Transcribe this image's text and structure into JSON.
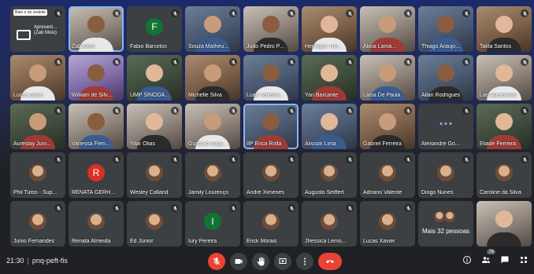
{
  "participants": [
    {
      "name": "Apresent... (Zeb Moio)",
      "kind": "screen",
      "caption": "Bato e do vedeite",
      "subcaption": "Apresent... (Zab Moio)"
    },
    {
      "name": "Zab Melo",
      "kind": "video",
      "style": "alt1",
      "speaking": true
    },
    {
      "name": "Fabio Barcelos",
      "kind": "avatar",
      "initial": "F",
      "color": "#137333"
    },
    {
      "name": "Souza Matheu...",
      "kind": "video",
      "style": "alt2"
    },
    {
      "name": "João Pedro P...",
      "kind": "video",
      "style": "alt1"
    },
    {
      "name": "Henrique Trin...",
      "kind": "video",
      "style": "alt3"
    },
    {
      "name": "Alicia Lama...",
      "kind": "video",
      "style": "alt1"
    },
    {
      "name": "Thiago Araujo...",
      "kind": "video",
      "style": "alt2"
    },
    {
      "name": "Talita Santos",
      "kind": "video",
      "style": "alt3"
    },
    {
      "name": "Lucas Grion",
      "kind": "video",
      "style": "alt3"
    },
    {
      "name": "William de Silv...",
      "kind": "video",
      "style": "alt5"
    },
    {
      "name": "UMP SINODA...",
      "kind": "video",
      "style": "alt4"
    },
    {
      "name": "Michelle Silva",
      "kind": "video",
      "style": "alt3"
    },
    {
      "name": "Luan Teixeira...",
      "kind": "video",
      "style": "alt2"
    },
    {
      "name": "Yan Barcante",
      "kind": "video",
      "style": "alt4"
    },
    {
      "name": "Laisa De Paula",
      "kind": "video",
      "style": "alt1"
    },
    {
      "name": "Allan Rodrigues",
      "kind": "video",
      "style": "alt2"
    },
    {
      "name": "Lais Ajevolinho",
      "kind": "video",
      "style": "alt1"
    },
    {
      "name": "Aureslay Juni...",
      "kind": "video",
      "style": "alt4"
    },
    {
      "name": "Vanessa Fern...",
      "kind": "video",
      "style": "alt1"
    },
    {
      "name": "Yitar Olias",
      "kind": "video",
      "style": "alt1"
    },
    {
      "name": "Gustavo Augu...",
      "kind": "video",
      "style": "alt1"
    },
    {
      "name": "IIP Erica Rolla",
      "kind": "video",
      "style": "alt2",
      "speaking": true
    },
    {
      "name": "Alisson Lima",
      "kind": "video",
      "style": "alt2"
    },
    {
      "name": "Gabriel Ferreira",
      "kind": "video",
      "style": "alt3"
    },
    {
      "name": "Alexandre Go...",
      "kind": "dots"
    },
    {
      "name": "Eliade Ferreira",
      "kind": "video",
      "style": "alt4"
    },
    {
      "name": "Phil Tutos - Sup...",
      "kind": "avatar-photo"
    },
    {
      "name": "RENATA GERH...",
      "kind": "avatar",
      "initial": "R",
      "color": "#d93025"
    },
    {
      "name": "Wesley Calland",
      "kind": "avatar-photo"
    },
    {
      "name": "Jamily Lourenço",
      "kind": "avatar-photo"
    },
    {
      "name": "André Ximenes",
      "kind": "avatar-photo"
    },
    {
      "name": "Augusto Seiffert",
      "kind": "avatar-photo"
    },
    {
      "name": "Adriano Valente",
      "kind": "avatar-photo"
    },
    {
      "name": "Diogo Nunes",
      "kind": "avatar-photo"
    },
    {
      "name": "Caroline da Silva",
      "kind": "avatar-photo"
    },
    {
      "name": "Junio Fernandes",
      "kind": "avatar-photo"
    },
    {
      "name": "Renata Almeida",
      "kind": "avatar-photo"
    },
    {
      "name": "Ed Júnior",
      "kind": "avatar-photo"
    },
    {
      "name": "Iury Pereira",
      "kind": "avatar",
      "initial": "I",
      "color": "#137333"
    },
    {
      "name": "Erick Morais",
      "kind": "avatar-photo"
    },
    {
      "name": "Jhéssica Lemo...",
      "kind": "avatar-photo"
    },
    {
      "name": "Lucas Xavier",
      "kind": "avatar-photo"
    },
    {
      "name": "",
      "kind": "more",
      "label": "Mais 32 pessoas"
    },
    {
      "name": "",
      "kind": "video",
      "style": "alt1",
      "self": true
    }
  ],
  "bar": {
    "time": "21:30",
    "separator": "|",
    "meeting_code": "pnq-peft-fis",
    "participants_count": "76"
  },
  "colors": {
    "accent": "#8ab4f8",
    "danger": "#ea4335",
    "tile": "#3c4043",
    "bar": "#202124"
  }
}
